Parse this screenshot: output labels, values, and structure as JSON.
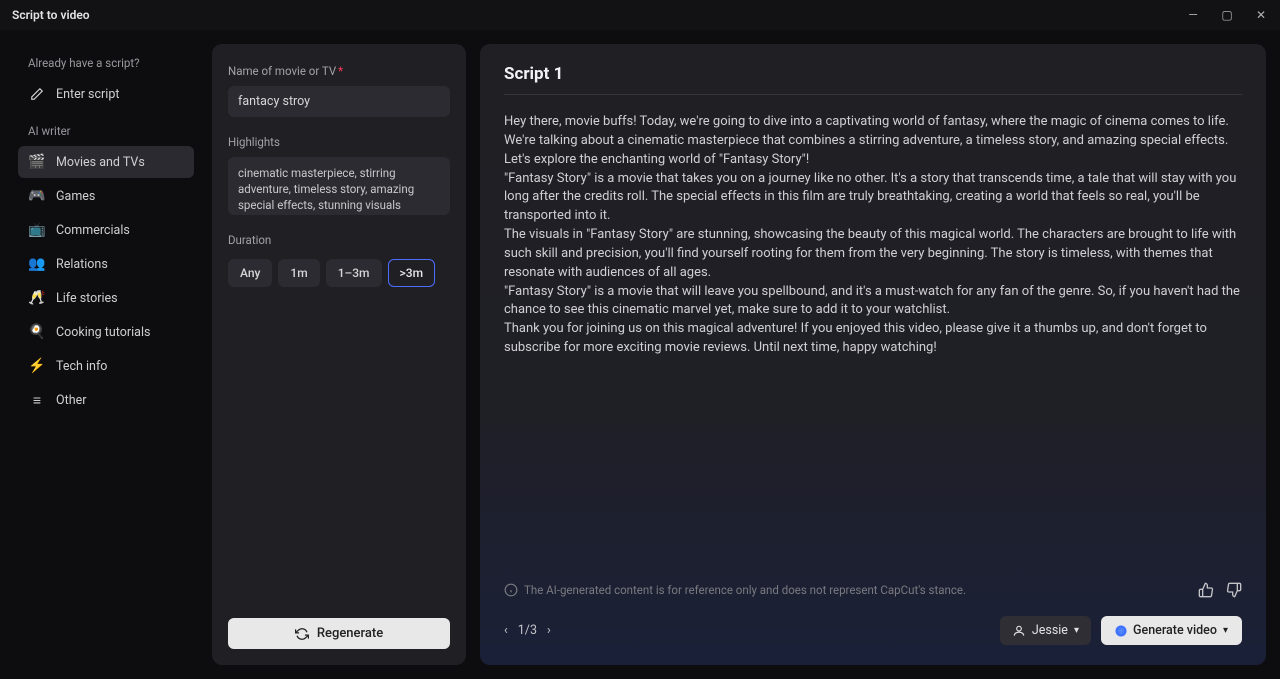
{
  "window": {
    "title": "Script to video"
  },
  "sidebar": {
    "section_script": "Already have a script?",
    "enter_script": "Enter script",
    "section_ai": "AI writer",
    "items": [
      {
        "label": "Movies and TVs",
        "icon": "🎬",
        "active": true
      },
      {
        "label": "Games",
        "icon": "🎮",
        "active": false
      },
      {
        "label": "Commercials",
        "icon": "📺",
        "active": false
      },
      {
        "label": "Relations",
        "icon": "👥",
        "active": false
      },
      {
        "label": "Life stories",
        "icon": "🥂",
        "active": false
      },
      {
        "label": "Cooking tutorials",
        "icon": "🍳",
        "active": false
      },
      {
        "label": "Tech info",
        "icon": "⚡",
        "active": false
      },
      {
        "label": "Other",
        "icon": "≡",
        "active": false
      }
    ]
  },
  "form": {
    "name_label": "Name of movie or TV",
    "name_value": "fantacy stroy",
    "highlights_label": "Highlights",
    "highlights_value": "cinematic masterpiece, stirring adventure, timeless story, amazing special effects, stunning visuals",
    "duration_label": "Duration",
    "durations": [
      "Any",
      "1m",
      "1–3m",
      ">3m"
    ],
    "duration_active": 3,
    "regenerate": "Regenerate"
  },
  "script": {
    "title": "Script 1",
    "body": "Hey there, movie buffs! Today, we're going to dive into a captivating world of fantasy, where the magic of cinema comes to life. We're talking about a cinematic masterpiece that combines a stirring adventure, a timeless story, and amazing special effects. Let's explore the enchanting world of \"Fantasy Story\"!\n\"Fantasy Story\" is a movie that takes you on a journey like no other. It's a story that transcends time, a tale that will stay with you long after the credits roll. The special effects in this film are truly breathtaking, creating a world that feels so real, you'll be transported into it.\nThe visuals in \"Fantasy Story\" are stunning, showcasing the beauty of this magical world. The characters are brought to life with such skill and precision, you'll find yourself rooting for them from the very beginning. The story is timeless, with themes that resonate with audiences of all ages.\n\"Fantasy Story\" is a movie that will leave you spellbound, and it's a must-watch for any fan of the genre. So, if you haven't had the chance to see this cinematic marvel yet, make sure to add it to your watchlist.\nThank you for joining us on this magical adventure! If you enjoyed this video, please give it a thumbs up, and don't forget to subscribe for more exciting movie reviews. Until next time, happy watching!",
    "disclaimer": "The AI-generated content is for reference only and does not represent CapCut's stance.",
    "page": "1/3",
    "voice_label": "Jessie",
    "generate_label": "Generate video"
  }
}
